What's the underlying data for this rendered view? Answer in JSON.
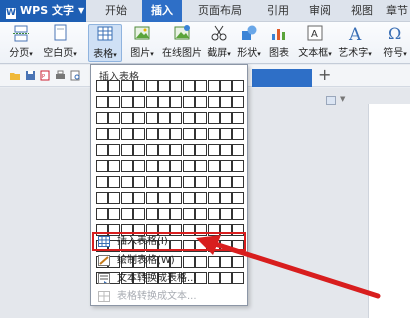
{
  "app": {
    "title": "WPS 文字"
  },
  "tabs": [
    {
      "label": "开始",
      "active": false
    },
    {
      "label": "插入",
      "active": true
    },
    {
      "label": "页面布局",
      "active": false
    },
    {
      "label": "引用",
      "active": false
    },
    {
      "label": "审阅",
      "active": false
    },
    {
      "label": "视图",
      "active": false
    },
    {
      "label": "章节",
      "active": false
    }
  ],
  "ribbon": {
    "page_break": "分页",
    "blank_page": "空白页",
    "table": "表格",
    "picture": "图片",
    "online_picture": "在线图片",
    "screenshot": "截屏",
    "shapes": "形状",
    "chart": "图表",
    "textbox": "文本框",
    "art_text": "艺术字",
    "symbol": "符号"
  },
  "dropdown": {
    "title": "插入表格",
    "grid_cols": 12,
    "grid_rows": 13,
    "items": [
      {
        "label": "插入表格(I)",
        "highlighted": true,
        "enabled": true
      },
      {
        "label": "绘制表格(W)",
        "highlighted": false,
        "enabled": true
      },
      {
        "label": "文本转换成表格...",
        "highlighted": false,
        "enabled": true
      },
      {
        "label": "表格转换成文本...",
        "highlighted": false,
        "enabled": false
      }
    ]
  },
  "colors": {
    "accent": "#2e6fc7",
    "annotation": "#d81e1e"
  }
}
